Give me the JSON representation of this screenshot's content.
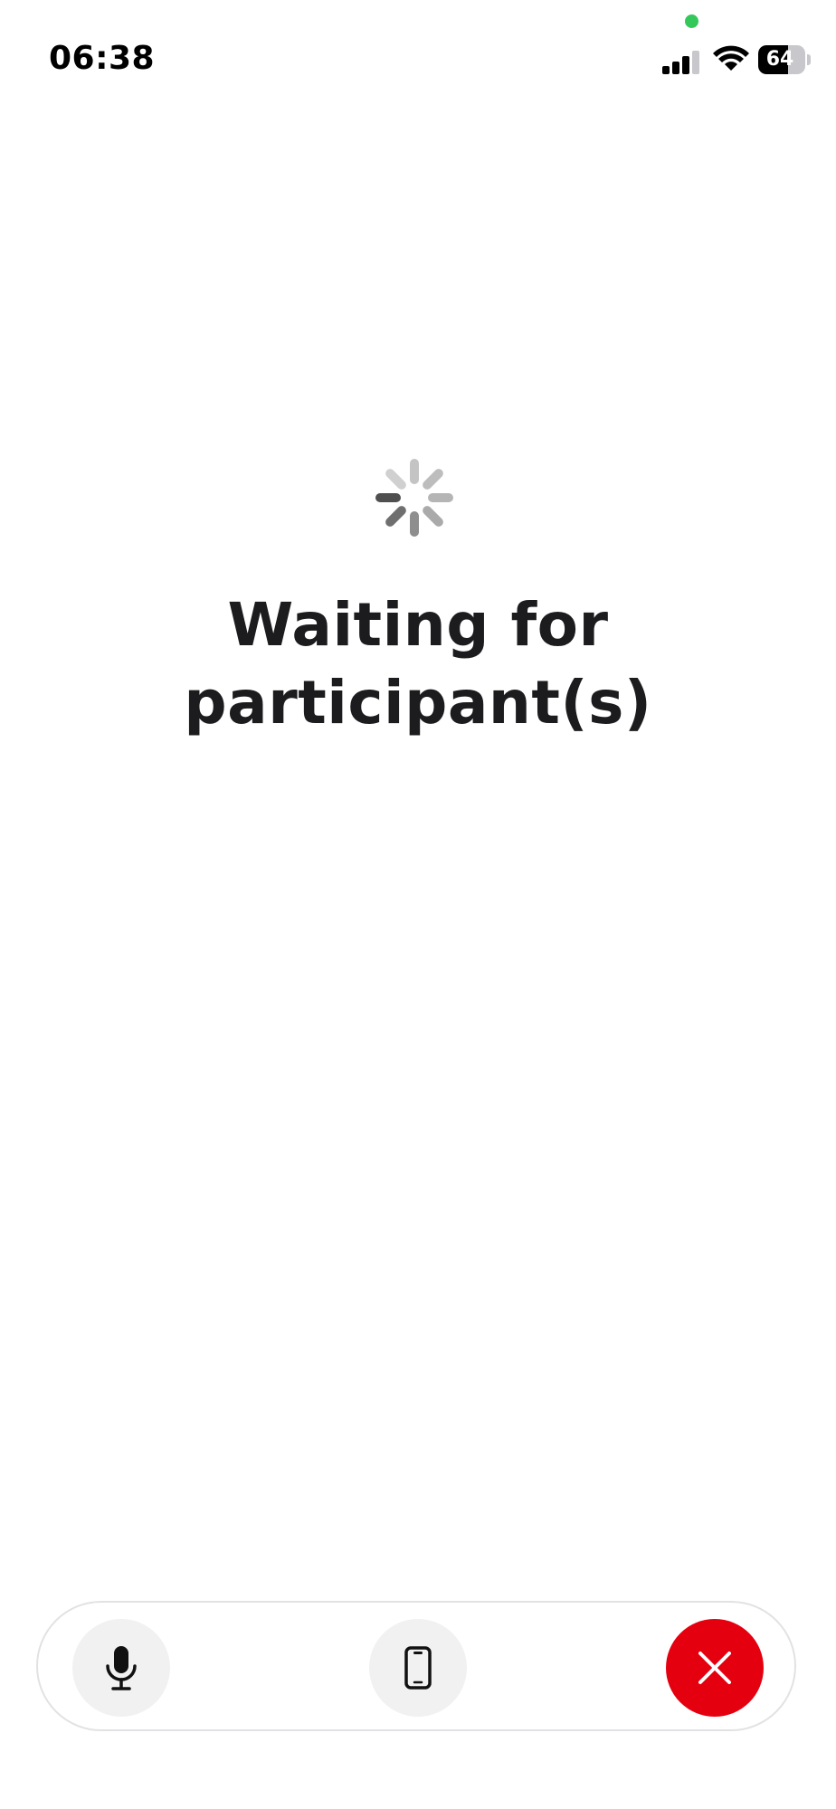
{
  "status_bar": {
    "time": "06:38",
    "battery_level": "64",
    "battery_fraction": 0.64,
    "signal_bars_active": 3,
    "privacy_indicator_color": "#34c759"
  },
  "main": {
    "spinner_icon": "loading-spinner-icon",
    "title": "Waiting for participant(s)"
  },
  "call_controls": {
    "buttons": [
      {
        "icon": "microphone-icon",
        "background": "#f1f1f2"
      },
      {
        "icon": "phone-device-icon",
        "background": "#f1f1f2"
      },
      {
        "icon": "close-icon",
        "background": "#e5000f"
      }
    ]
  }
}
